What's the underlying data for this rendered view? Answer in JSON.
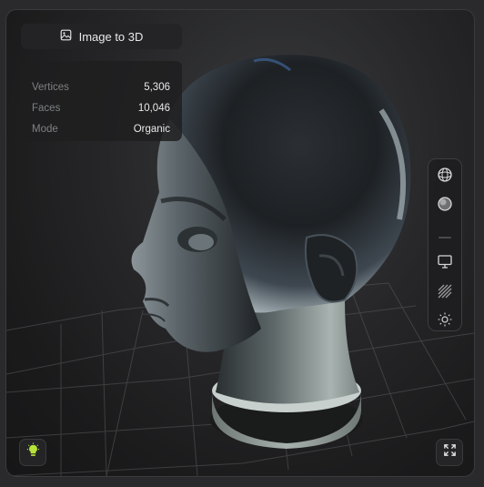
{
  "header": {
    "mode_label": "Image to 3D",
    "mode_icon": "image-icon"
  },
  "stats": [
    {
      "label": "Vertices",
      "value": "5,306"
    },
    {
      "label": "Faces",
      "value": "10,046"
    },
    {
      "label": "Mode",
      "value": "Organic"
    }
  ],
  "toolbar": {
    "items": [
      {
        "icon": "wireframe-sphere-icon",
        "label": ""
      },
      {
        "icon": "shaded-sphere-icon",
        "label": ""
      },
      {
        "icon": "monitor-icon",
        "label": ""
      },
      {
        "icon": "texture-hatch-icon",
        "label": ""
      },
      {
        "icon": "sun-icon",
        "label": ""
      }
    ]
  },
  "bottom": {
    "light_icon": "lightbulb-icon",
    "fullscreen_icon": "fullscreen-icon"
  },
  "colors": {
    "accent_light": "#b7e23a",
    "panel": "#242426",
    "viewport_bg": "#1c1c1d"
  }
}
